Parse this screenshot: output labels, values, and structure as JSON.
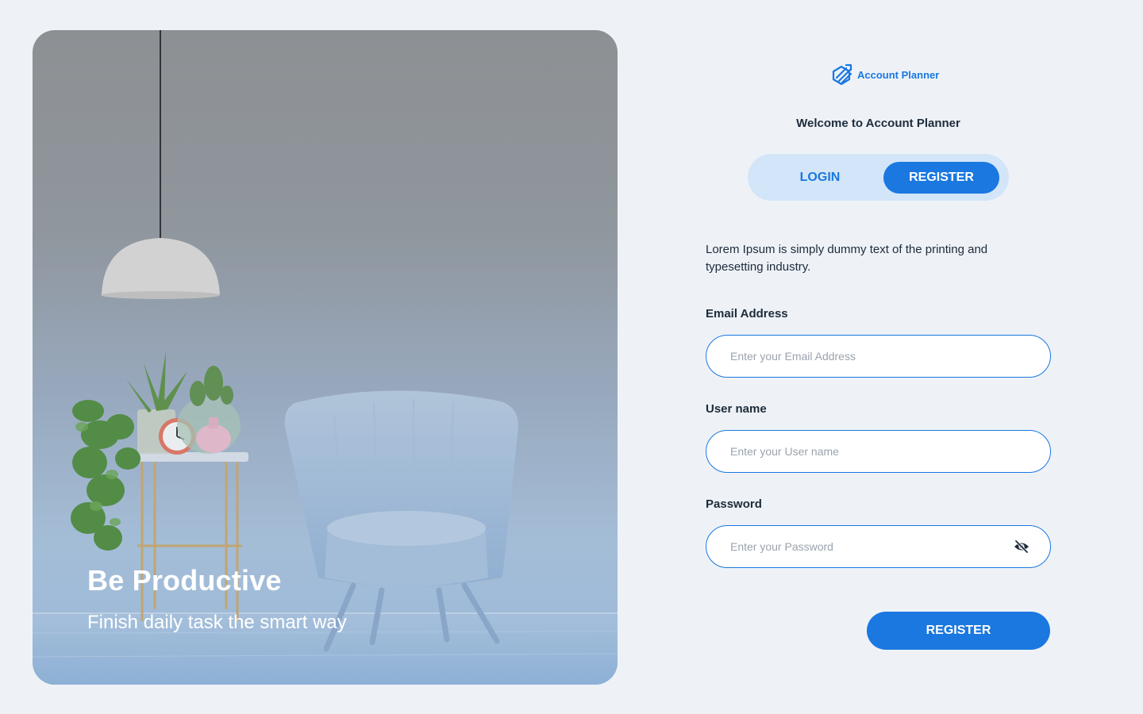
{
  "hero": {
    "title": "Be Productive",
    "subtitle": "Finish daily task the smart way"
  },
  "brand": {
    "name": "Account Planner",
    "icon": "account-planner-logo-icon",
    "color": "#1a78e0"
  },
  "welcome": "Welcome to Account Planner",
  "tabs": {
    "login": "LOGIN",
    "register": "REGISTER",
    "active": "register"
  },
  "intro": "Lorem Ipsum is simply dummy text of the printing and typesetting industry.",
  "form": {
    "email": {
      "label": "Email Address",
      "placeholder": "Enter your Email Address",
      "value": ""
    },
    "username": {
      "label": "User name",
      "placeholder": "Enter your User name",
      "value": ""
    },
    "password": {
      "label": "Password",
      "placeholder": "Enter your Password",
      "value": "",
      "toggle_icon": "eye-slash-icon"
    },
    "submit_label": "REGISTER"
  },
  "colors": {
    "accent": "#1a78e0",
    "page_background": "#eef2f7",
    "toggle_background": "#d3e5f8"
  }
}
